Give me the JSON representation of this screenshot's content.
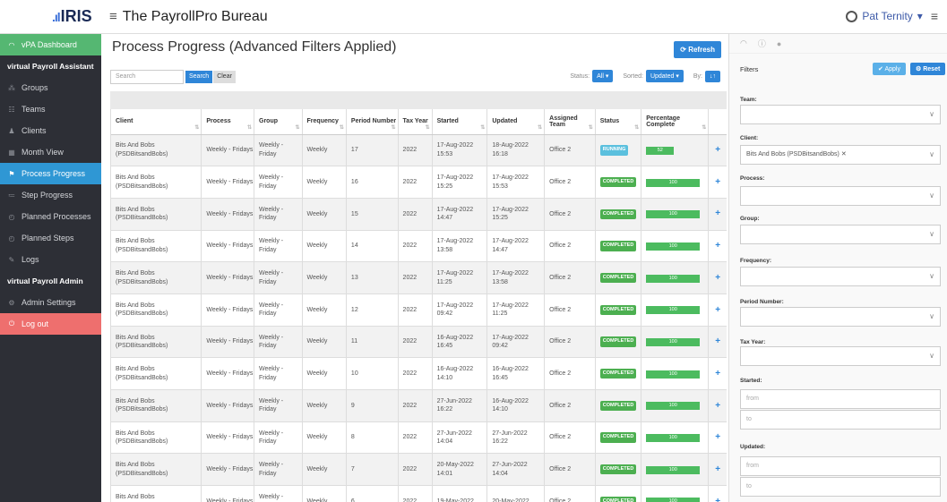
{
  "app": {
    "logo": "IRIS",
    "bureau": "The PayrollPro Bureau",
    "user": "Pat Ternity"
  },
  "sidebar": {
    "items": [
      {
        "label": "vPA Dashboard",
        "icon": "dashboard-icon",
        "state": "green"
      },
      {
        "label": "virtual Payroll Assistant",
        "type": "header"
      },
      {
        "label": "Groups",
        "icon": "groups-icon"
      },
      {
        "label": "Teams",
        "icon": "teams-icon"
      },
      {
        "label": "Clients",
        "icon": "clients-icon"
      },
      {
        "label": "Month View",
        "icon": "calendar-icon"
      },
      {
        "label": "Process Progress",
        "icon": "flag-icon",
        "state": "active"
      },
      {
        "label": "Step Progress",
        "icon": "list-icon"
      },
      {
        "label": "Planned Processes",
        "icon": "clock-icon"
      },
      {
        "label": "Planned Steps",
        "icon": "clock-icon"
      },
      {
        "label": "Logs",
        "icon": "logs-icon"
      },
      {
        "label": "virtual Payroll Admin",
        "type": "header"
      },
      {
        "label": "Admin Settings",
        "icon": "gear-icon"
      },
      {
        "label": "Log out",
        "icon": "logout-icon",
        "state": "red"
      }
    ]
  },
  "main": {
    "title": "Process Progress (Advanced Filters Applied)",
    "refresh": "Refresh",
    "search_placeholder": "Search",
    "search_btn": "Search",
    "clear_btn": "Clear",
    "status_label": "Status:",
    "status_value": "All",
    "sorted_label": "Sorted:",
    "sorted_value": "Updated",
    "by_label": "By:"
  },
  "table": {
    "headers": [
      "Client",
      "Process",
      "Group",
      "Frequency",
      "Period Number",
      "Tax Year",
      "Started",
      "Updated",
      "Assigned Team",
      "Status",
      "Percentage Complete",
      ""
    ],
    "rows": [
      {
        "client": "Bits And Bobs (PSDBitsandBobs)",
        "process": "Weekly - Fridays",
        "group": "Weekly - Friday",
        "freq": "Weekly",
        "period": "17",
        "year": "2022",
        "started": "17-Aug-2022 15:53",
        "updated": "18-Aug-2022 16:18",
        "team": "Office 2",
        "status": "RUNNING",
        "pct": "52"
      },
      {
        "client": "Bits And Bobs (PSDBitsandBobs)",
        "process": "Weekly - Fridays",
        "group": "Weekly - Friday",
        "freq": "Weekly",
        "period": "16",
        "year": "2022",
        "started": "17-Aug-2022 15:25",
        "updated": "17-Aug-2022 15:53",
        "team": "Office 2",
        "status": "COMPLETED",
        "pct": "100"
      },
      {
        "client": "Bits And Bobs (PSDBitsandBobs)",
        "process": "Weekly - Fridays",
        "group": "Weekly - Friday",
        "freq": "Weekly",
        "period": "15",
        "year": "2022",
        "started": "17-Aug-2022 14:47",
        "updated": "17-Aug-2022 15:25",
        "team": "Office 2",
        "status": "COMPLETED",
        "pct": "100"
      },
      {
        "client": "Bits And Bobs (PSDBitsandBobs)",
        "process": "Weekly - Fridays",
        "group": "Weekly - Friday",
        "freq": "Weekly",
        "period": "14",
        "year": "2022",
        "started": "17-Aug-2022 13:58",
        "updated": "17-Aug-2022 14:47",
        "team": "Office 2",
        "status": "COMPLETED",
        "pct": "100"
      },
      {
        "client": "Bits And Bobs (PSDBitsandBobs)",
        "process": "Weekly - Fridays",
        "group": "Weekly - Friday",
        "freq": "Weekly",
        "period": "13",
        "year": "2022",
        "started": "17-Aug-2022 11:25",
        "updated": "17-Aug-2022 13:58",
        "team": "Office 2",
        "status": "COMPLETED",
        "pct": "100"
      },
      {
        "client": "Bits And Bobs (PSDBitsandBobs)",
        "process": "Weekly - Fridays",
        "group": "Weekly - Friday",
        "freq": "Weekly",
        "period": "12",
        "year": "2022",
        "started": "17-Aug-2022 09:42",
        "updated": "17-Aug-2022 11:25",
        "team": "Office 2",
        "status": "COMPLETED",
        "pct": "100"
      },
      {
        "client": "Bits And Bobs (PSDBitsandBobs)",
        "process": "Weekly - Fridays",
        "group": "Weekly - Friday",
        "freq": "Weekly",
        "period": "11",
        "year": "2022",
        "started": "16-Aug-2022 16:45",
        "updated": "17-Aug-2022 09:42",
        "team": "Office 2",
        "status": "COMPLETED",
        "pct": "100"
      },
      {
        "client": "Bits And Bobs (PSDBitsandBobs)",
        "process": "Weekly - Fridays",
        "group": "Weekly - Friday",
        "freq": "Weekly",
        "period": "10",
        "year": "2022",
        "started": "16-Aug-2022 14:10",
        "updated": "16-Aug-2022 16:45",
        "team": "Office 2",
        "status": "COMPLETED",
        "pct": "100"
      },
      {
        "client": "Bits And Bobs (PSDBitsandBobs)",
        "process": "Weekly - Fridays",
        "group": "Weekly - Friday",
        "freq": "Weekly",
        "period": "9",
        "year": "2022",
        "started": "27-Jun-2022 16:22",
        "updated": "16-Aug-2022 14:10",
        "team": "Office 2",
        "status": "COMPLETED",
        "pct": "100"
      },
      {
        "client": "Bits And Bobs (PSDBitsandBobs)",
        "process": "Weekly - Fridays",
        "group": "Weekly - Friday",
        "freq": "Weekly",
        "period": "8",
        "year": "2022",
        "started": "27-Jun-2022 14:04",
        "updated": "27-Jun-2022 16:22",
        "team": "Office 2",
        "status": "COMPLETED",
        "pct": "100"
      },
      {
        "client": "Bits And Bobs (PSDBitsandBobs)",
        "process": "Weekly - Fridays",
        "group": "Weekly - Friday",
        "freq": "Weekly",
        "period": "7",
        "year": "2022",
        "started": "20-May-2022 14:01",
        "updated": "27-Jun-2022 14:04",
        "team": "Office 2",
        "status": "COMPLETED",
        "pct": "100"
      },
      {
        "client": "Bits And Bobs (PSDBitsandBobs)",
        "process": "Weekly - Fridays",
        "group": "Weekly - Friday",
        "freq": "Weekly",
        "period": "6",
        "year": "2022",
        "started": "19-May-2022",
        "updated": "20-May-2022",
        "team": "Office 2",
        "status": "COMPLETED",
        "pct": "100"
      }
    ]
  },
  "filters": {
    "title": "Filters",
    "apply": "Apply",
    "reset": "Reset",
    "team_label": "Team:",
    "client_label": "Client:",
    "client_value": "Bits And Bobs (PSDBitsandBobs)",
    "process_label": "Process:",
    "group_label": "Group:",
    "frequency_label": "Frequency:",
    "period_label": "Period Number:",
    "taxyear_label": "Tax Year:",
    "started_label": "Started:",
    "updated_label": "Updated:",
    "from_placeholder": "from",
    "to_placeholder": "to"
  }
}
